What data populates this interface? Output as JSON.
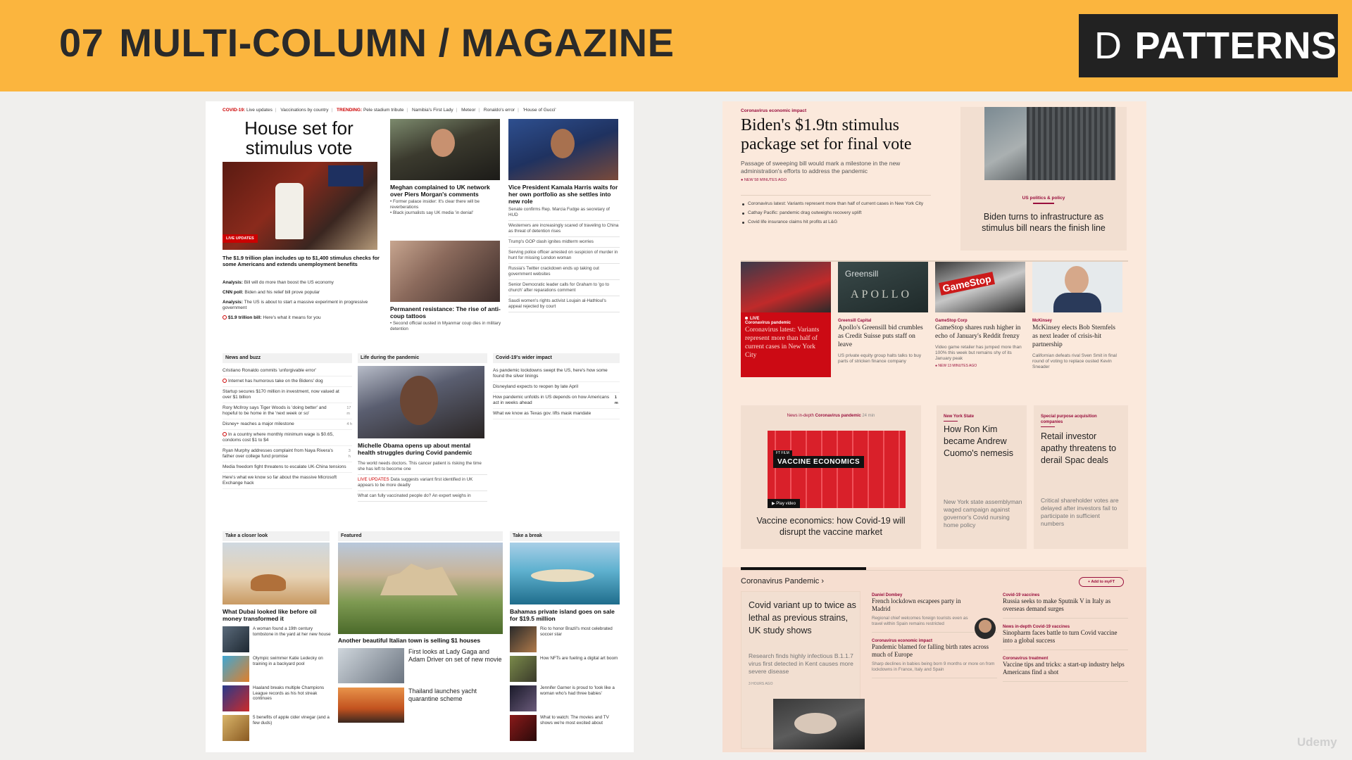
{
  "banner": {
    "number": "07",
    "title": "MULTI-COLUMN / MAGAZINE",
    "badge_logo": "D",
    "badge_text": "PATTERNS"
  },
  "cnn": {
    "trending": {
      "covid_label": "COVID-19:",
      "links": [
        "Live updates",
        "Vaccinations by country"
      ],
      "trending_label": "TRENDING:",
      "trending_links": [
        "Pele stadium tribute",
        "Namibia's First Lady",
        "Meteor",
        "Ronaldo's error",
        "'House of Gucci'"
      ]
    },
    "hero": {
      "headline": "House set for stimulus vote",
      "badge": "LIVE UPDATES",
      "caption": "The $1.9 trillion plan includes up to $1,400 stimulus checks for some Americans and extends unemployment benefits",
      "bullets": [
        {
          "lead": "Analysis:",
          "text": "Bill will do more than boost the US economy"
        },
        {
          "lead": "CNN poll:",
          "text": "Biden and his relief bill prove popular"
        },
        {
          "lead": "Analysis:",
          "text": "The US is about to start a massive experiment in progressive government"
        },
        {
          "lead": "$1.9 trillion bill:",
          "text": "Here's what it means for you"
        }
      ]
    },
    "meghan": {
      "headline": "Meghan complained to UK network over Piers Morgan's comments",
      "bullets": [
        "Former palace insider: It's clear there will be reverberations",
        "Black journalists say UK media 'in denial'"
      ]
    },
    "tattoo": {
      "headline": "Permanent resistance: The rise of anti-coup tattoos",
      "bullets": [
        "Second official ousted in Myanmar coup dies in military detention"
      ]
    },
    "kamala": {
      "headline": "Vice President Kamala Harris waits for her own portfolio as she settles into new role",
      "stack": [
        "Senate confirms Rep. Marcia Fudge as secretary of HUD",
        "Westerners are increasingly scared of traveling to China as threat of detention rises",
        "Trump's GOP clash ignites midterm worries",
        "Serving police officer arrested on suspicion of murder in hunt for missing London woman",
        "Russia's Twitter crackdown ends up taking out government websites",
        "Senior Democratic leader calls for Graham to 'go to church' after reparations comment",
        "Saudi women's rights activist Loujain al-Hathloul's appeal rejected by court"
      ]
    },
    "news_buzz": {
      "heading": "News and buzz",
      "rows": [
        {
          "text": "Cristiano Ronaldo commits 'unforgivable error'",
          "time": ""
        },
        {
          "text": "Internet has humorous take on the Bidens' dog",
          "time": ""
        },
        {
          "text": "Startup secures $170 million in investment, now valued at over $1 billion",
          "time": ""
        },
        {
          "text": "Rory McIlroy says Tiger Woods is 'doing better' and hopeful to be home in the 'next week or so'",
          "time": "17 m"
        },
        {
          "text": "Disney+ reaches a major milestone",
          "time": "4 h"
        },
        {
          "text": "In a country where monthly minimum wage is $0.65, condoms cost $1 to $4",
          "time": ""
        },
        {
          "text": "Ryan Murphy addresses complaint from Naya Rivera's father over college fund promise",
          "time": "3 h"
        },
        {
          "text": "Media freedom fight threatens to escalate UK-China tensions",
          "time": ""
        },
        {
          "text": "Here's what we know so far about the massive Microsoft Exchange hack",
          "time": ""
        }
      ]
    },
    "life_pandemic": {
      "heading": "Life during the pandemic",
      "headline": "Michelle Obama opens up about mental health struggles during Covid pandemic",
      "rows": [
        "The world needs doctors. This cancer patient is risking the time she has left to become one",
        "Data suggests variant first identified in UK appears to be more deadly",
        "What can fully vaccinated people do? An expert weighs in"
      ],
      "live_label": "LIVE UPDATES"
    },
    "covid_wider": {
      "heading": "Covid-19's wider impact",
      "rows": [
        {
          "text": "As pandemic lockdowns swept the US, here's how some found the silver linings",
          "time": ""
        },
        {
          "text": "Disneyland expects to reopen by late April",
          "time": ""
        },
        {
          "text": "How pandemic unfolds in US depends on how Americans act in weeks ahead",
          "time": "1 m"
        },
        {
          "text": "What we know as Texas gov. lifts mask mandate",
          "time": ""
        }
      ]
    },
    "closer_look": {
      "heading": "Take a closer look",
      "headline": "What Dubai looked like before oil money transformed it",
      "rows": [
        "A woman found a 19th century tombstone in the yard at her new house",
        "Olympic swimmer Katie Ledecky on training in a backyard pool",
        "Haaland breaks multiple Champions League records as his hot streak continues",
        "5 benefits of apple cider vinegar (and a few duds)"
      ]
    },
    "featured": {
      "heading": "Featured",
      "headline": "Another beautiful Italian town is selling $1 houses",
      "rows": [
        "First looks at Lady Gaga and Adam Driver on set of new movie",
        "Thailand launches yacht quarantine scheme"
      ]
    },
    "take_break": {
      "heading": "Take a break",
      "headline": "Bahamas private island goes on sale for $19.5 million",
      "rows": [
        "Rio to honor Brazil's most celebrated soccer star",
        "How NFTs are fueling a digital art boom",
        "Jennifer Garner is proud to 'look like a woman who's had three babies'",
        "What to watch: The movies and TV shows we're most excited about"
      ]
    }
  },
  "ft": {
    "lead": {
      "kicker": "Coronavirus economic impact",
      "headline": "Biden's $1.9tn stimulus package set for final vote",
      "standfirst": "Passage of sweeping bill would mark a milestone in the new administration's efforts to address the pandemic",
      "timestamp": "NEW 58 MINUTES AGO",
      "bullets": [
        "Coronavirus latest: Variants represent more than half of current cases in New York City",
        "Cathay Pacific: pandemic drag outweighs recovery uplift",
        "Covid life insurance claims hit profits at L&G"
      ]
    },
    "lead_card": {
      "kicker": "US politics & policy",
      "headline": "Biden turns to infrastructure as stimulus bill nears the finish line"
    },
    "stories": [
      {
        "kicker": "Coronavirus pandemic",
        "live": "LIVE",
        "headline": "Coronavirus latest: Variants represent more than half of current cases in New York City",
        "standfirst": "",
        "timestamp": ""
      },
      {
        "kicker": "Greensill Capital",
        "img_text": "Greensill",
        "img_text2": "APOLLO",
        "headline": "Apollo's Greensill bid crumbles as Credit Suisse puts staff on leave",
        "standfirst": "US private equity group halts talks to buy parts of stricken finance company",
        "timestamp": ""
      },
      {
        "kicker": "GameStop Corp",
        "img_text": "GameStop",
        "headline": "GameStop shares rush higher in echo of January's Reddit frenzy",
        "standfirst": "Video game retailer has jumped more than 100% this week but remains shy of its January peak",
        "timestamp": "NEW 13 MINUTES AGO"
      },
      {
        "kicker": "McKinsey",
        "headline": "McKinsey elects Bob Sternfels as next leader of crisis-hit partnership",
        "standfirst": "Californian defeats rival Sven Smit in final round of voting to replace ousted Kevin Sneader",
        "timestamp": ""
      }
    ],
    "video_card": {
      "kicker": "News in-depth",
      "kicker_topic": "Coronavirus pandemic",
      "duration": "24 min",
      "film_label": "FT FILM",
      "film_title": "VACCINE ECONOMICS",
      "play": "Play video",
      "headline": "Vaccine economics: how Covid-19 will disrupt the vaccine market"
    },
    "ron_card": {
      "kicker": "New York State",
      "headline": "How Ron Kim became Andrew Cuomo's nemesis",
      "standfirst": "New York state assemblyman waged campaign against governor's Covid nursing home policy"
    },
    "spac_card": {
      "kicker": "Special purpose acquisition companies",
      "headline": "Retail investor apathy threatens to derail Spac deals",
      "standfirst": "Critical shareholder votes are delayed after investors fail to participate in sufficient numbers"
    },
    "bottom": {
      "section": "Coronavirus Pandemic",
      "chevron": "›",
      "myft": "+ Add to myFT",
      "feature": {
        "headline": "Covid variant up to twice as lethal as previous strains, UK study shows",
        "standfirst": "Research finds highly infectious B.1.1.7 virus first detected in Kent causes more severe disease",
        "timestamp": "3 HOURS AGO"
      },
      "mid_list": [
        {
          "kicker": "Daniel Dombey",
          "headline": "French lockdown escapees party in Madrid",
          "standfirst": "Regional chief welcomes foreign tourists even as travel within Spain remains restricted"
        },
        {
          "kicker": "Coronavirus economic impact",
          "headline": "Pandemic blamed for falling birth rates across much of Europe",
          "standfirst": "Sharp declines in babies being born 9 months or more on from lockdowns in France, Italy and Spain"
        }
      ],
      "right_list": [
        {
          "kicker": "Covid-19 vaccines",
          "headline": "Russia seeks to make Sputnik V in Italy as overseas demand surges"
        },
        {
          "kicker": "News in-depth Covid-19 vaccines",
          "headline": "Sinopharm faces battle to turn Covid vaccine into a global success"
        },
        {
          "kicker": "Coronavirus treatment",
          "headline": "Vaccine tips and tricks: a start-up industry helps Americans find a shot"
        }
      ]
    }
  },
  "watermark": "Udemy"
}
